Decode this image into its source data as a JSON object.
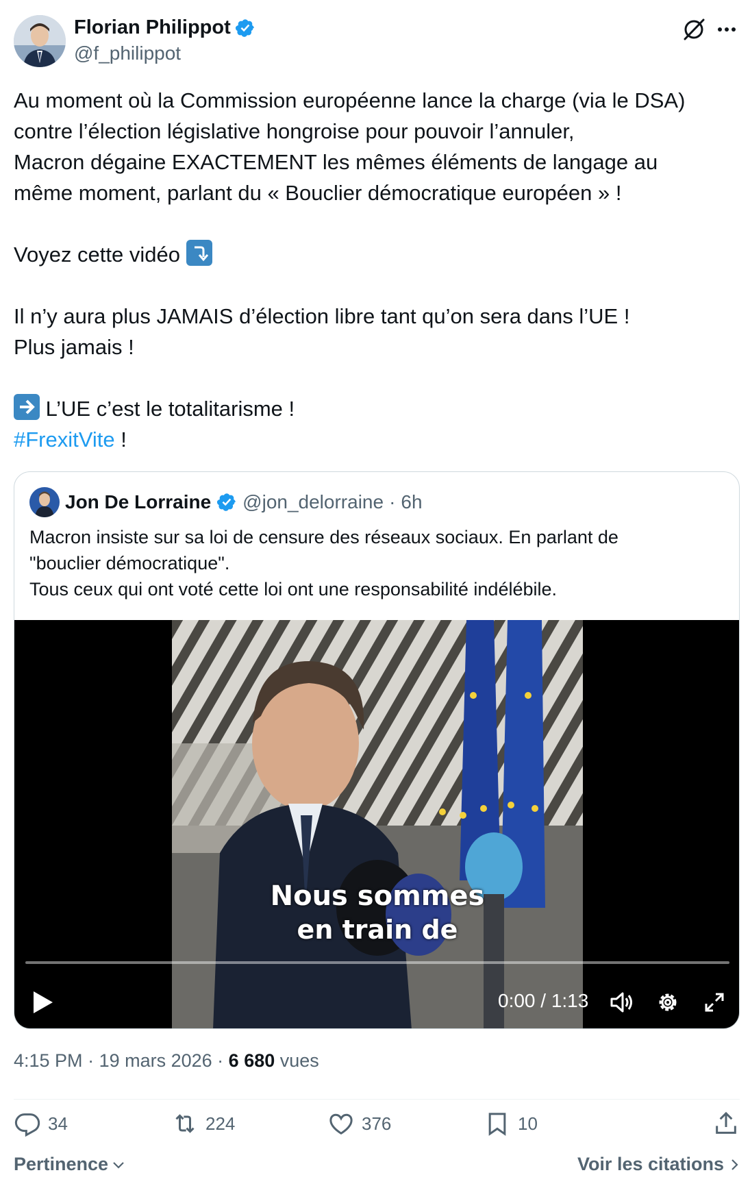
{
  "author": {
    "name": "Florian Philippot",
    "handle": "@f_philippot"
  },
  "post": {
    "lines": [
      "Au moment où la Commission européenne lance la charge (via le DSA)",
      "contre l’élection législative hongroise pour pouvoir l’annuler,",
      "Macron dégaine EXACTEMENT les mêmes éléments de langage au",
      "même moment, parlant du « Bouclier démocratique européen » !"
    ],
    "video_line": "Voyez cette vidéo",
    "free_election_line": "Il n’y aura plus JAMAIS d’élection libre tant qu’on sera dans l’UE !",
    "never_line": "Plus jamais !",
    "totalitarian_line": "L’UE c’est le totalitarisme !",
    "hashtag": "#FrexitVite",
    "hashtag_suffix": " !"
  },
  "quoted": {
    "name": "Jon De Lorraine",
    "handle": "@jon_delorraine",
    "separator": "·",
    "age": "6h",
    "lines": [
      "Macron insiste sur sa loi de censure des réseaux sociaux. En parlant de",
      "\"bouclier démocratique\".",
      "Tous ceux qui ont voté cette loi ont une responsabilité indélébile."
    ],
    "video": {
      "caption_line1": "Nous sommes",
      "caption_line2": "en train de",
      "time": "0:00 / 1:13",
      "progress": 0
    }
  },
  "meta": {
    "time": "4:15 PM",
    "sep1": " · ",
    "date": "19 mars 2026",
    "sep2": " · ",
    "views": "6 680",
    "views_label": " vues"
  },
  "actions": {
    "replies": "34",
    "reposts": "224",
    "likes": "376",
    "bookmarks": "10"
  },
  "footer": {
    "sort_label": "Pertinence",
    "quotes_label": "Voir les citations"
  },
  "colors": {
    "accent": "#1d9bf0",
    "secondary_text": "#536471",
    "primary_text": "#0f1419",
    "emoji_blue": "#3b88c3"
  }
}
